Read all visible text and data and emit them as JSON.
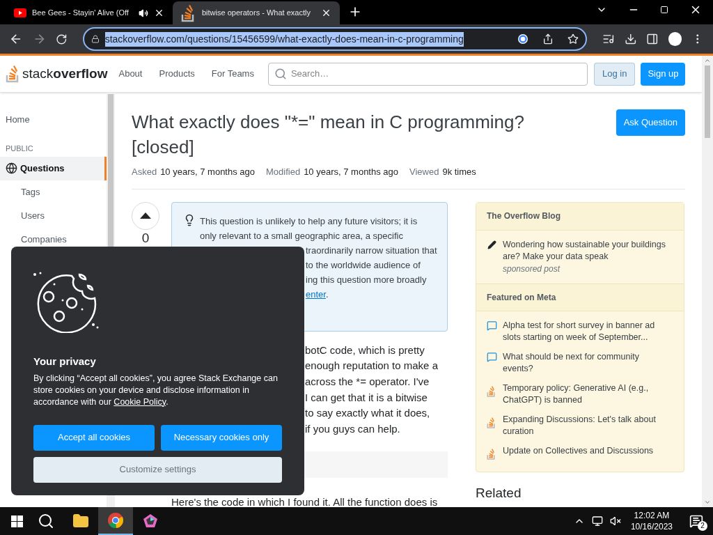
{
  "browser": {
    "tabs": [
      {
        "title": "Bee Gees - Stayin' Alive (Off",
        "audio": true,
        "selected": false
      },
      {
        "title": "bitwise operators - What exactly",
        "audio": false,
        "selected": true
      }
    ],
    "url": "stackoverflow.com/questions/15456599/what-exactly-does-mean-in-c-programming"
  },
  "site_header": {
    "logo": [
      "stack",
      "overflow"
    ],
    "nav": [
      "About",
      "Products",
      "For Teams"
    ],
    "search_placeholder": "Search…",
    "login": "Log in",
    "signup": "Sign up"
  },
  "left_nav": [
    {
      "label": "Home",
      "kind": "link",
      "selected": false
    },
    {
      "label": "PUBLIC",
      "kind": "heading"
    },
    {
      "label": "Questions",
      "kind": "link",
      "selected": true
    },
    {
      "label": "Tags",
      "kind": "sublink",
      "selected": false
    },
    {
      "label": "Users",
      "kind": "sublink",
      "selected": false
    },
    {
      "label": "Companies",
      "kind": "sublink",
      "selected": false
    }
  ],
  "question": {
    "title": "What exactly does \"*=\" mean in C programming?",
    "status": "[closed]",
    "ask_button": "Ask Question",
    "meta": [
      {
        "label": "Asked",
        "value": "10 years, 7 months ago"
      },
      {
        "label": "Modified",
        "value": "10 years, 7 months ago"
      },
      {
        "label": "Viewed",
        "value": "9k times"
      }
    ],
    "votes": "0",
    "notice_lines": [
      "This question is unlikely to help any future visitors; it is",
      "only relevant to a small geographic area, a specific"
    ],
    "notice_fragments": [
      "traordinarily narrow situation that",
      "to the worldwide audience of",
      "ing this question more broadly"
    ],
    "notice_link": "enter",
    "notice_link_suffix": ".",
    "body_fragments": [
      "botC code, which is pretty",
      "enough reputation to make a",
      "across the *= operator. I've",
      "I can get that it is a bitwise",
      "to say exactly what it does,",
      "if you guys can help."
    ],
    "next_paragraph": "Here's the code in which I found it. All the function does is"
  },
  "sidebar": [
    {
      "title": "The Overflow Blog",
      "items": [
        {
          "text": "Wondering how sustainable your buildings are? Make your data speak",
          "note": "sponsored post",
          "kind": "blog"
        }
      ]
    },
    {
      "title": "Featured on Meta",
      "items": [
        {
          "text": "Alpha test for short survey in banner ad slots starting on week of September...",
          "kind": "meta"
        },
        {
          "text": "What should be next for community events?",
          "kind": "meta"
        },
        {
          "text": "Temporary policy: Generative AI (e.g., ChatGPT) is banned",
          "kind": "site"
        },
        {
          "text": "Expanding Discussions: Let's talk about curation",
          "kind": "site"
        },
        {
          "text": "Update on Collectives and Discussions",
          "kind": "site"
        }
      ]
    }
  ],
  "related": "Related",
  "cookie": {
    "title": "Your privacy",
    "text": "By clicking “Accept all cookies”, you agree Stack Exchange can store cookies on your device and disclose information in accordance with our",
    "link": "Cookie Policy",
    "suffix": ".",
    "accept": "Accept all cookies",
    "necessary": "Necessary cookies only",
    "customize": "Customize settings"
  },
  "taskbar": {
    "apps": [
      {
        "kind": "search",
        "selected": false
      },
      {
        "kind": "folder",
        "selected": false
      },
      {
        "kind": "chrome",
        "selected": true
      },
      {
        "kind": "pentagon",
        "selected": false
      }
    ],
    "time": "12:02 AM",
    "date": "10/16/2023",
    "notifications": "2"
  }
}
